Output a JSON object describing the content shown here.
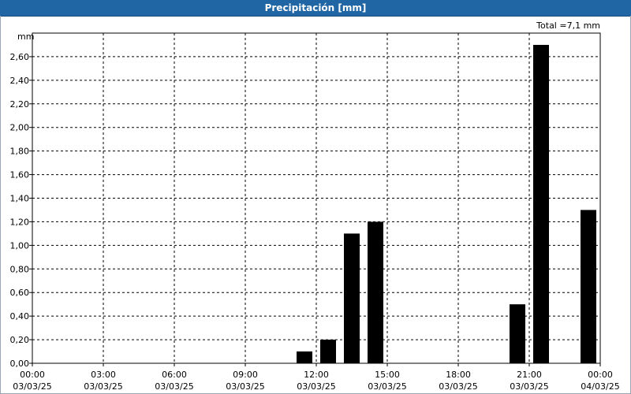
{
  "window": {
    "title": "Precipitación [mm]"
  },
  "chart_data": {
    "type": "bar",
    "title": "Precipitación [mm]",
    "ylabel": "mm",
    "xlabel": "",
    "total_label": "Total =7,1 mm",
    "ylim": [
      0,
      2.8
    ],
    "y_ticks": [
      "0,00",
      "0,20",
      "0,40",
      "0,60",
      "0,80",
      "1,00",
      "1,20",
      "1,40",
      "1,60",
      "1,80",
      "2,00",
      "2,20",
      "2,40",
      "2,60"
    ],
    "x_range_hours": [
      0,
      24
    ],
    "x_ticks": [
      {
        "time": "00:00",
        "date": "03/03/25"
      },
      {
        "time": "03:00",
        "date": "03/03/25"
      },
      {
        "time": "06:00",
        "date": "03/03/25"
      },
      {
        "time": "09:00",
        "date": "03/03/25"
      },
      {
        "time": "12:00",
        "date": "03/03/25"
      },
      {
        "time": "15:00",
        "date": "03/03/25"
      },
      {
        "time": "18:00",
        "date": "03/03/25"
      },
      {
        "time": "21:00",
        "date": "03/03/25"
      },
      {
        "time": "00:00",
        "date": "04/03/25"
      }
    ],
    "grid": true,
    "bar_color": "#000000",
    "bars": [
      {
        "time": "11:30",
        "value": 0.1
      },
      {
        "time": "12:30",
        "value": 0.2
      },
      {
        "time": "13:30",
        "value": 1.1
      },
      {
        "time": "14:30",
        "value": 1.2
      },
      {
        "time": "20:30",
        "value": 0.5
      },
      {
        "time": "21:30",
        "value": 2.7
      },
      {
        "time": "23:30",
        "value": 1.3
      }
    ]
  }
}
